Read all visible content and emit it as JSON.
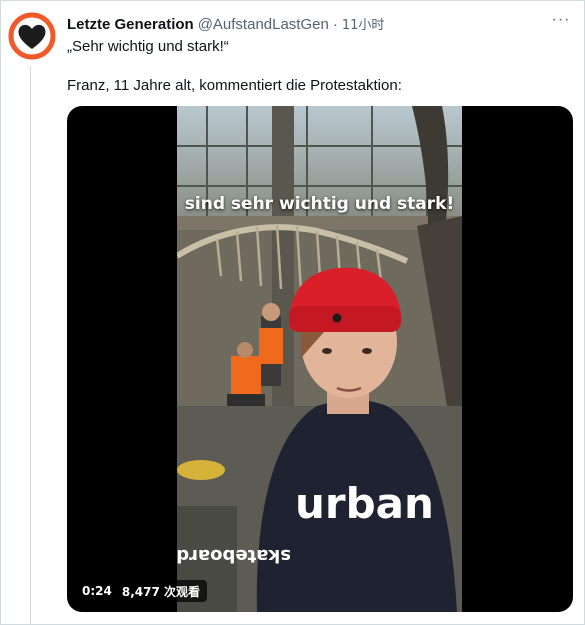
{
  "tweet": {
    "display_name": "Letzte Generation",
    "handle": "@AufstandLastGen",
    "separator": "·",
    "time_ago": "11小时",
    "text_line1": "„Sehr wichtig und stark!“",
    "text_line2": "Franz, 11 Jahre alt, kommentiert die Protestaktion:"
  },
  "avatar": {
    "icon": "heart-logo-icon",
    "ring_color": "#f05a28",
    "heart_color": "#1c1c1c"
  },
  "menu": {
    "icon": "more-options-icon",
    "glyph": "···"
  },
  "video": {
    "caption": "sind sehr wichtig und stark!",
    "duration": "0:24",
    "views": "8,477 次观看",
    "beanie_color": "#d81f2a",
    "vest_color": "#f06a1e"
  },
  "colors": {
    "border": "#cfd9de",
    "text": "#0f1419",
    "secondary": "#536471"
  }
}
